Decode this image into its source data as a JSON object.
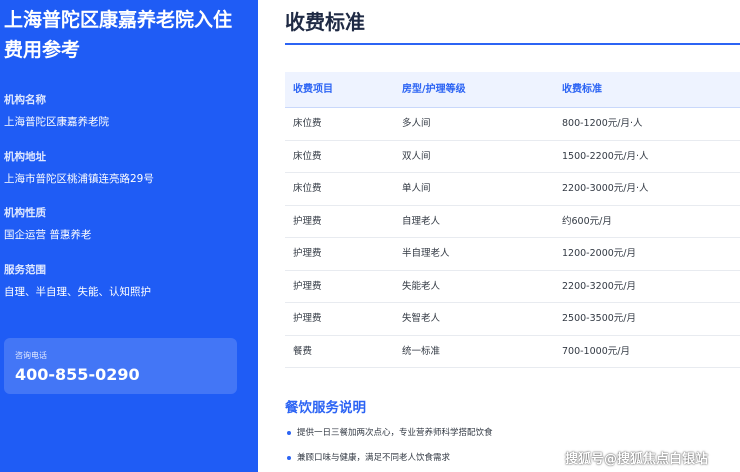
{
  "sidebar": {
    "title_line1": "上海普陀区康嘉养老院入住",
    "title_line2": "费用参考",
    "fields": [
      {
        "label": "机构名称",
        "value": "上海普陀区康嘉养老院"
      },
      {
        "label": "机构地址",
        "value": "上海市普陀区桃浦镇连亮路29号"
      },
      {
        "label": "机构性质",
        "value": "国企运营 普惠养老"
      },
      {
        "label": "服务范围",
        "value": "自理、半自理、失能、认知照护"
      }
    ],
    "contact": {
      "label": "咨询电话",
      "phone": "400-855-0290"
    }
  },
  "main": {
    "title": "收费标准",
    "table": {
      "headers": [
        "收费项目",
        "房型/护理等级",
        "收费标准"
      ],
      "rows": [
        [
          "床位费",
          "多人间",
          "800-1200元/月·人"
        ],
        [
          "床位费",
          "双人间",
          "1500-2200元/月·人"
        ],
        [
          "床位费",
          "单人间",
          "2200-3000元/月·人"
        ],
        [
          "护理费",
          "自理老人",
          "约600元/月"
        ],
        [
          "护理费",
          "半自理老人",
          "1200-2000元/月"
        ],
        [
          "护理费",
          "失能老人",
          "2200-3200元/月"
        ],
        [
          "护理费",
          "失智老人",
          "2500-3500元/月"
        ],
        [
          "餐费",
          "统一标准",
          "700-1000元/月"
        ]
      ]
    },
    "dining": {
      "title": "餐饮服务说明",
      "items": [
        "提供一日三餐加两次点心，专业营养师科学搭配饮食",
        "兼顾口味与健康，满足不同老人饮食需求"
      ]
    }
  },
  "watermark": "搜狐号@搜狐焦点白银站",
  "colors": {
    "sidebar_bg": "#1f5cf5",
    "accent": "#2c64f4",
    "header_bg": "#eef3ff"
  }
}
